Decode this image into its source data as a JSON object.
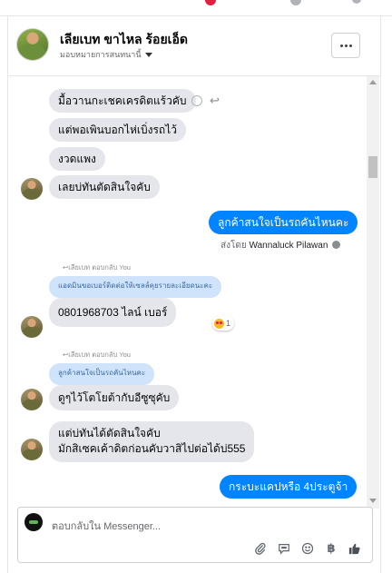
{
  "header": {
    "title": "เลียเบท ขาไหล ร้อยเอ็ด",
    "subtitle": "มอบหมายการสนทนานี้"
  },
  "messages": [
    {
      "dir": "in",
      "text": "มื้อวานกะเชคเครดิตแร้วคับ"
    },
    {
      "dir": "in",
      "text": "แต่พอเพินบอกไห่เบิ่งรถไว้"
    },
    {
      "dir": "in",
      "text": "งวดแพง"
    },
    {
      "dir": "in",
      "text": "เลยบ่ทันตัดสินใจคับ"
    },
    {
      "dir": "out",
      "text": "ลูกค้าสนใจเป็นรถคันไหนคะ"
    },
    {
      "dir": "in",
      "text": "0801968703 ไลน์ เบอร์",
      "reply_label": "เลียเบท ตอบกลับ You",
      "quote": "แอดมินขอเบอร์ติดต่อให้เซลล์คุยรายละเอียดนะคะ",
      "reaction_count": "1"
    },
    {
      "dir": "in",
      "text": "ดูๆไว้โตโยต้ากับอีซูซุคับ",
      "reply_label": "เลียเบท ตอบกลับ You",
      "quote": "ลูกค้าสนใจเป็นรถคันไหนคะ"
    },
    {
      "dir": "in",
      "lines": [
        "แต่บ่ทันได้ตัดสินใจคับ",
        "มักสิเซคเค้าดิตก่อนคับวาสิไปต่อได้บ่555"
      ]
    },
    {
      "dir": "out",
      "text": "กระบะแคปหรือ 4ประตูจ้า"
    }
  ],
  "sent_by": {
    "prefix": "ส่งโดย",
    "name": "Wannaluck Pilawan"
  },
  "composer": {
    "placeholder": "ตอบกลับใน Messenger..."
  },
  "icons": [
    "smile-icon",
    "reply-arrow-icon",
    "more-dots-icon",
    "info-icon",
    "attachment-icon",
    "sticker-icon",
    "emoji-icon",
    "baht-icon",
    "thumbs-up-icon"
  ],
  "colors": {
    "outgoing_bubble": "#0084ff",
    "incoming_bubble": "#e4e6eb",
    "quote_bubble": "#cfe3fb"
  }
}
